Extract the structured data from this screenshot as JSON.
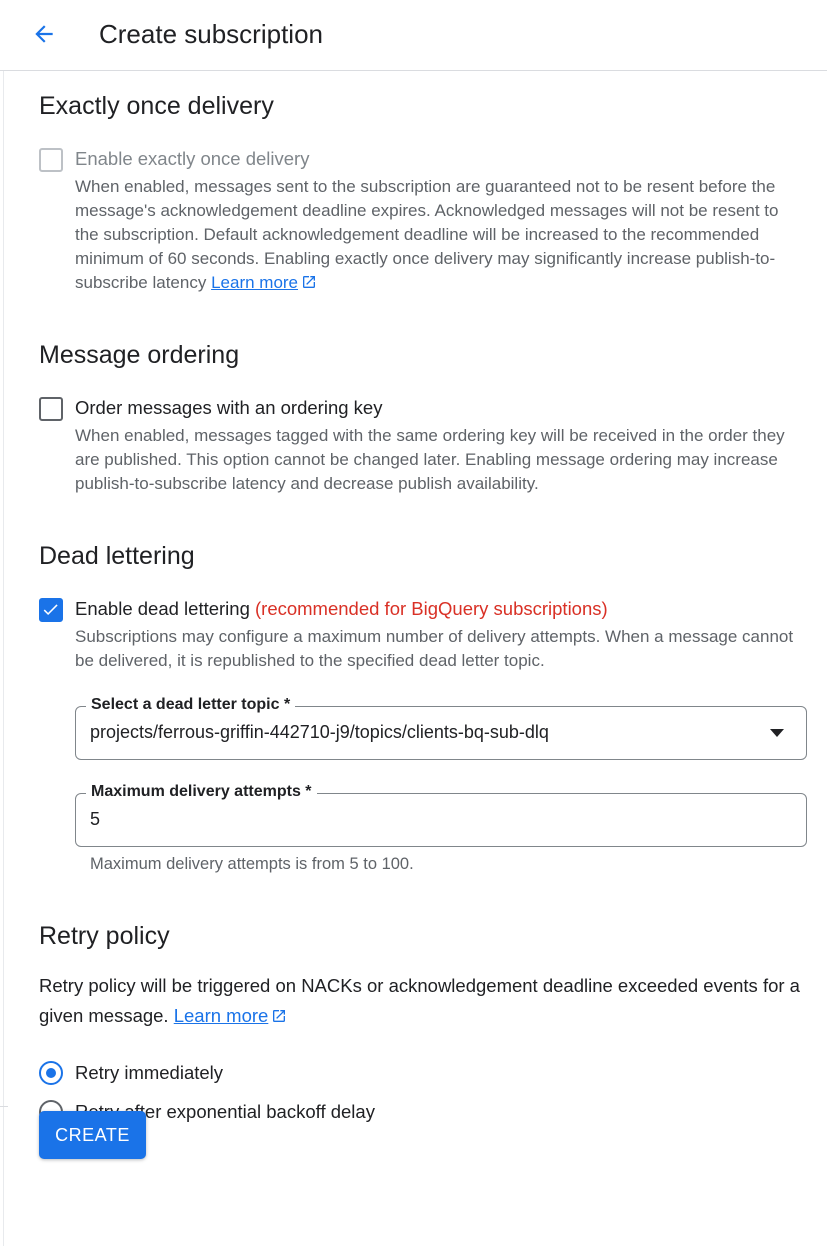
{
  "header": {
    "title": "Create subscription"
  },
  "exactly_once": {
    "heading": "Exactly once delivery",
    "checkbox_label": "Enable exactly once delivery",
    "description": "When enabled, messages sent to the subscription are guaranteed not to be resent before the message's acknowledgement deadline expires. Acknowledged messages will not be resent to the subscription. Default acknowledgement deadline will be increased to the recommended minimum of 60 seconds. Enabling exactly once delivery may significantly increase publish-to-subscribe latency",
    "learn_more": "Learn more",
    "checked": false,
    "disabled": true
  },
  "message_ordering": {
    "heading": "Message ordering",
    "checkbox_label": "Order messages with an ordering key",
    "description": "When enabled, messages tagged with the same ordering key will be received in the order they are published. This option cannot be changed later. Enabling message ordering may increase publish-to-subscribe latency and decrease publish availability.",
    "checked": false
  },
  "dead_lettering": {
    "heading": "Dead lettering",
    "checkbox_label": "Enable dead lettering",
    "recommendation": "(recommended for BigQuery subscriptions)",
    "description": "Subscriptions may configure a maximum number of delivery attempts. When a message cannot be delivered, it is republished to the specified dead letter topic.",
    "checked": true,
    "topic_field": {
      "label": "Select a dead letter topic *",
      "value": "projects/ferrous-griffin-442710-j9/topics/clients-bq-sub-dlq"
    },
    "attempts_field": {
      "label": "Maximum delivery attempts *",
      "value": "5",
      "hint": "Maximum delivery attempts is from 5 to 100."
    }
  },
  "retry_policy": {
    "heading": "Retry policy",
    "description": "Retry policy will be triggered on NACKs or acknowledgement deadline exceeded events for a given message.",
    "learn_more": "Learn more",
    "options": [
      {
        "label": "Retry immediately",
        "selected": true
      },
      {
        "label": "Retry after exponential backoff delay",
        "selected": false
      }
    ]
  },
  "actions": {
    "create_label": "CREATE"
  },
  "colors": {
    "primary": "#1a73e8",
    "recommendation": "#d93025",
    "muted_text": "#5f6368"
  }
}
